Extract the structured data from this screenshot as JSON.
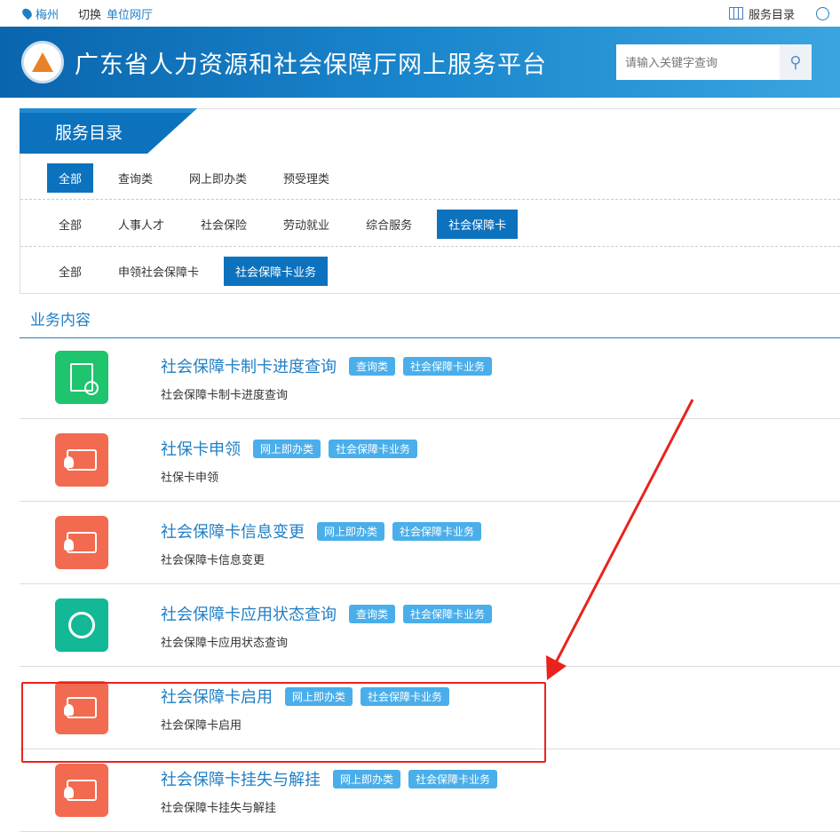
{
  "topbar": {
    "city": "梅州",
    "switch": "切换",
    "unit_hall": "单位网厅",
    "catalog": "服务目录"
  },
  "banner": {
    "title": "广东省人力资源和社会保障厅网上服务平台",
    "search_placeholder": "请输入关键字查询"
  },
  "panel": {
    "tab": "服务目录",
    "row1": [
      "全部",
      "查询类",
      "网上即办类",
      "预受理类"
    ],
    "row2": [
      "全部",
      "人事人才",
      "社会保险",
      "劳动就业",
      "综合服务",
      "社会保障卡"
    ],
    "row3": [
      "全部",
      "申领社会保障卡",
      "社会保障卡业务"
    ]
  },
  "section": "业务内容",
  "items": [
    {
      "title": "社会保障卡制卡进度查询",
      "tags": [
        "查询类",
        "社会保障卡业务"
      ],
      "desc": "社会保障卡制卡进度查询",
      "icon": "doc-search",
      "color": "#1ec46e"
    },
    {
      "title": "社保卡申领",
      "tags": [
        "网上即办类",
        "社会保障卡业务"
      ],
      "desc": "社保卡申领",
      "icon": "id-card",
      "color": "#f26a50"
    },
    {
      "title": "社会保障卡信息变更",
      "tags": [
        "网上即办类",
        "社会保障卡业务"
      ],
      "desc": "社会保障卡信息变更",
      "icon": "id-card",
      "color": "#f26a50"
    },
    {
      "title": "社会保障卡应用状态查询",
      "tags": [
        "查询类",
        "社会保障卡业务"
      ],
      "desc": "社会保障卡应用状态查询",
      "icon": "magnifier",
      "color": "#13b896"
    },
    {
      "title": "社会保障卡启用",
      "tags": [
        "网上即办类",
        "社会保障卡业务"
      ],
      "desc": "社会保障卡启用",
      "icon": "id-card",
      "color": "#f26a50"
    },
    {
      "title": "社会保障卡挂失与解挂",
      "tags": [
        "网上即办类",
        "社会保障卡业务"
      ],
      "desc": "社会保障卡挂失与解挂",
      "icon": "id-card",
      "color": "#f26a50"
    }
  ],
  "annotation_color": "#e8231d"
}
